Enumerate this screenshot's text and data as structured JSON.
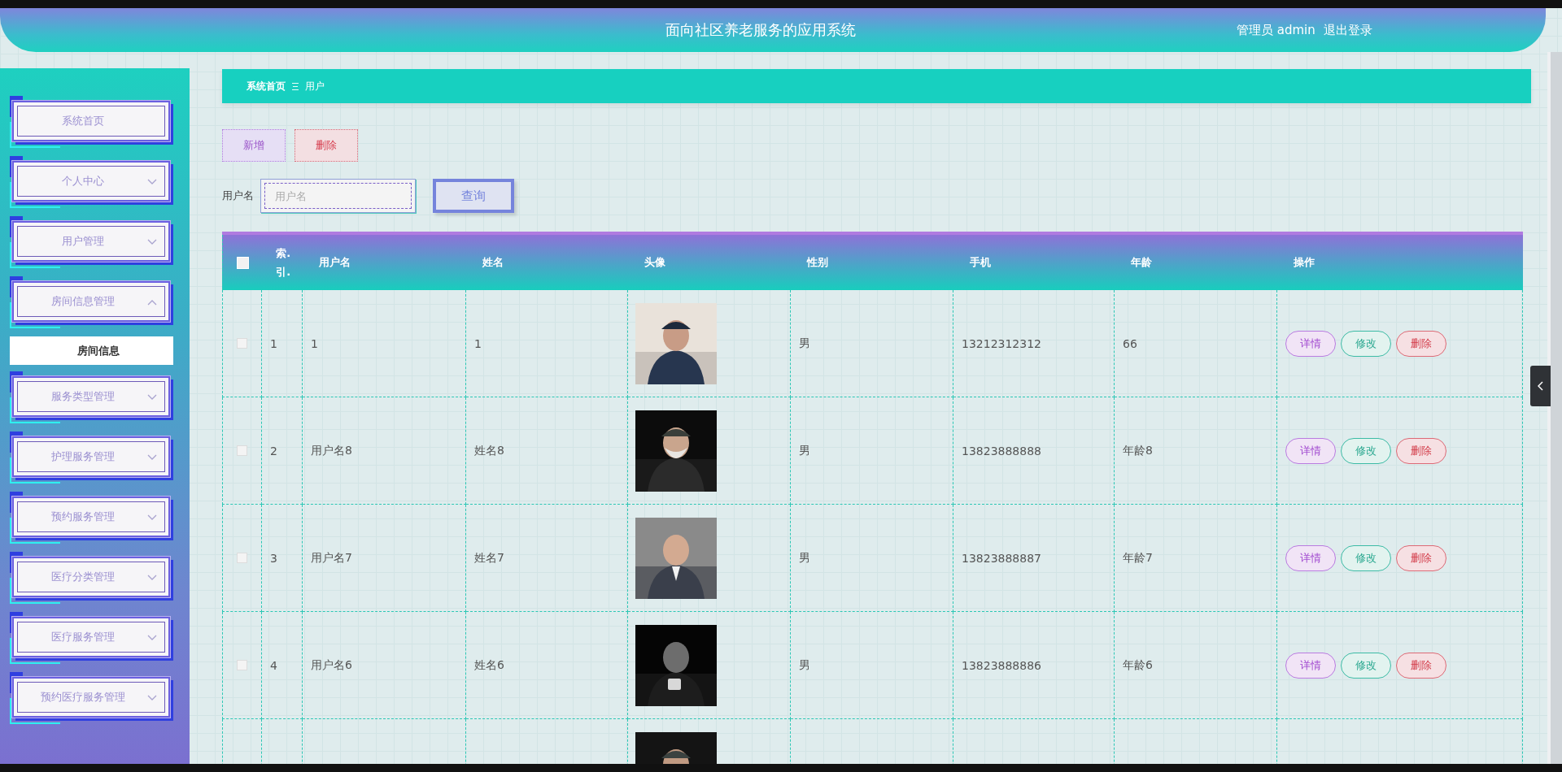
{
  "header": {
    "title": "面向社区养老服务的应用系统",
    "user": "管理员 admin",
    "logout": "退出登录"
  },
  "sidebar": {
    "items": [
      {
        "label": "系统首页",
        "kind": "link"
      },
      {
        "label": "个人中心",
        "kind": "submenu",
        "expanded": false
      },
      {
        "label": "用户管理",
        "kind": "submenu",
        "expanded": false
      },
      {
        "label": "房间信息管理",
        "kind": "submenu",
        "expanded": true,
        "children": [
          {
            "label": "房间信息",
            "kind": "link"
          }
        ]
      },
      {
        "label": "服务类型管理",
        "kind": "submenu",
        "expanded": false
      },
      {
        "label": "护理服务管理",
        "kind": "submenu",
        "expanded": false
      },
      {
        "label": "预约服务管理",
        "kind": "submenu",
        "expanded": false
      },
      {
        "label": "医疗分类管理",
        "kind": "submenu",
        "expanded": false
      },
      {
        "label": "医疗服务管理",
        "kind": "submenu",
        "expanded": false
      },
      {
        "label": "预约医疗服务管理",
        "kind": "submenu",
        "expanded": false
      }
    ]
  },
  "breadcrumb": [
    {
      "label": "系统首页"
    },
    {
      "label": "用户"
    }
  ],
  "toolbar": {
    "buttons": [
      {
        "label": "新增",
        "kind": "add"
      },
      {
        "label": "删除",
        "kind": "delete"
      }
    ]
  },
  "search": {
    "label": "用户名",
    "placeholder": "用户名",
    "button": "查询"
  },
  "table": {
    "columns": [
      {
        "kind": "check",
        "checked": false
      },
      {
        "kind": "text",
        "label": "索.引."
      },
      {
        "kind": "text",
        "label": "用户名"
      },
      {
        "kind": "text",
        "label": "姓名"
      },
      {
        "kind": "text",
        "label": "头像"
      },
      {
        "kind": "text",
        "label": "性别"
      },
      {
        "kind": "text",
        "label": "手机"
      },
      {
        "kind": "text",
        "label": "年龄"
      },
      {
        "kind": "text",
        "label": "操作"
      }
    ],
    "rows": [
      {
        "checked": false,
        "index": "1",
        "username": "1",
        "name": "1",
        "avatar": {
          "kind": "picture"
        },
        "gender": "男",
        "phone": "13212312312",
        "age": "66",
        "actions": [
          {
            "label": "详情",
            "kind": "detail"
          },
          {
            "label": "修改",
            "kind": "edit"
          },
          {
            "label": "删除",
            "kind": "delete"
          }
        ]
      },
      {
        "checked": false,
        "index": "2",
        "username": "用户名8",
        "name": "姓名8",
        "avatar": {
          "kind": "picture"
        },
        "gender": "男",
        "phone": "13823888888",
        "age": "年龄8",
        "actions": [
          {
            "label": "详情",
            "kind": "detail"
          },
          {
            "label": "修改",
            "kind": "edit"
          },
          {
            "label": "删除",
            "kind": "delete"
          }
        ]
      },
      {
        "checked": false,
        "index": "3",
        "username": "用户名7",
        "name": "姓名7",
        "avatar": {
          "kind": "picture"
        },
        "gender": "男",
        "phone": "13823888887",
        "age": "年龄7",
        "actions": [
          {
            "label": "详情",
            "kind": "detail"
          },
          {
            "label": "修改",
            "kind": "edit"
          },
          {
            "label": "删除",
            "kind": "delete"
          }
        ]
      },
      {
        "checked": false,
        "index": "4",
        "username": "用户名6",
        "name": "姓名6",
        "avatar": {
          "kind": "picture"
        },
        "gender": "男",
        "phone": "13823888886",
        "age": "年龄6",
        "actions": [
          {
            "label": "详情",
            "kind": "detail"
          },
          {
            "label": "修改",
            "kind": "edit"
          },
          {
            "label": "删除",
            "kind": "delete"
          }
        ]
      },
      {
        "avatar": {
          "kind": "picture"
        }
      }
    ]
  }
}
